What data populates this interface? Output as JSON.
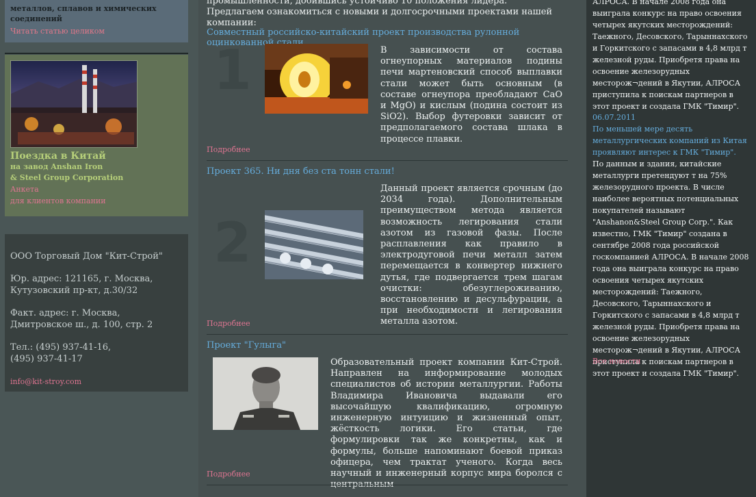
{
  "left": {
    "article_box": {
      "title_line1": "металлов, сплавов и химических",
      "title_line2": "соединений",
      "read_more": "Читать статью целиком"
    },
    "china_trip": {
      "title": "Поездка в Китай",
      "sub1": "на завод Anshan Iron",
      "sub2": "& Steel Group Corporation",
      "form": "Анкета",
      "for_clients": "для клиентов компании"
    },
    "contacts": {
      "company": "ООО Торговый Дом \"Кит-Строй\"",
      "legal_1": "Юр. адрес: 121165, г. Москва,",
      "legal_2": "Кутузовский пр-кт, д.30/32",
      "actual_1": "Факт. адрес: г. Москва,",
      "actual_2": "Дмитровское ш., д. 100, стр. 2",
      "phone_1": "Тел.: (495) 937-41-16,",
      "phone_2": "(495) 937-41-17",
      "email": "info@kit-stroy.com"
    }
  },
  "main": {
    "intro_1": "промышленности, добившись устойчиво 10 положения лидера.",
    "intro_2": "Предлагаем ознакомиться с новыми и долгосрочными проектами нашей компании:",
    "projects": [
      {
        "number": "1",
        "title": "Совместный российско-китайский проект производства рулонной оцинкованной стали",
        "text": "В зависимости от состава огнеупорных материалов подины печи мартеновский способ выплавки стали может быть основным (в составе огнеупора преобладают CaO и MgO) и кислым (подина состоит из SiO2). Выбор футеровки зависит от предполагаемого состава шлака в процессе плавки.",
        "more": "Подробнее"
      },
      {
        "number": "2",
        "title": "Проект 365. Ни дня без ста тонн стали!",
        "text": "Данный проект является срочным (до 2034 года). Дополнительным преимуществом метода является возможность легирования стали азотом из газовой фазы. После расплавления как правило в электродуговой печи металл затем перемещается в конвертер нижнего дутья, где подвергается трем шагам очистки: обезуглероживанию, восстановлению и десульфурации, а при необходимости и легирования металла азотом.",
        "more": "Подробнее"
      },
      {
        "title": "Проект \"Гулыга\"",
        "text": "Образовательный проект компании Кит-Строй. Направлен на информирование молодых специалистов об истории металлургии. Работы Владимира Ивановича выдавали его высочайшую квалификацию, огромную инженерную интуицию и жизненный опыт, жёсткость логики. Его статьи, где формулировки так же конкретны, как и формулы, больше напоминают боевой приказ офицера, чем трактат ученого. Когда весь научный и инженерный корпус мира боролся с центральным",
        "more": "Подробнее"
      }
    ]
  },
  "right": {
    "news_top": "АЛРОСА. В начале 2008 года она выиграла конкурс на право освоения четырех якутских месторождений: Таежного, Десовского, Тарыннахского и Горкитского с запасами в 4,8 млрд т железной руды. Приобретя права на освоение железорудных месторож¬дений в Якутии, АЛРОСА приступила к поискам партнеров в этот проект и создала ГМК \"Тимир\".",
    "news_date": "06.07.2011",
    "news_head": "По меньшей мере десять металлургических компаний из Китая проявляют интерес к ГМК \"Тимир\".",
    "news_body": "По данным и здания, китайские металлурги претендуют т на 75% железорудного проекта. В числе наиболее вероятных потенциальных покупателей называют \"Anshanon&Steel Group Corp.\". Как известно, ГМК \"Тимир\" создана в сентябре 2008 года российской госкомпанией АЛРОСА. В начале 2008 года она выиграла конкурс на право освоения четырех якутских месторождений: Таежного, Десовского, Тарыннахского и Горкитского с запасами в 4,8 млрд т железной руды. Приобретя права на освоение железорудных месторож¬дений в Якутии, АЛРОСА приступила к поискам партнеров в этот проект и создала ГМК \"Тимир\".",
    "all_news": "Все новости"
  }
}
